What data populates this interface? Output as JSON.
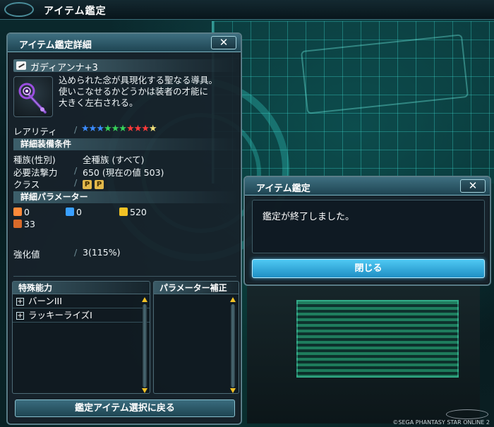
{
  "topbar": {
    "title": "アイテム鑑定"
  },
  "detail": {
    "title": "アイテム鑑定詳細",
    "close": "✕",
    "item_name": "ガディアンナ+3",
    "description": [
      "込められた念が具現化する聖なる導具。",
      "使いこなせるかどうかは装者の才能に",
      "大きく左右される。"
    ],
    "rarity_label": "レアリティ",
    "rarity_stars": [
      {
        "color": "#3b8cff"
      },
      {
        "color": "#3b8cff"
      },
      {
        "color": "#3b8cff"
      },
      {
        "color": "#37d35a"
      },
      {
        "color": "#37d35a"
      },
      {
        "color": "#37d35a"
      },
      {
        "color": "#ff3a3a"
      },
      {
        "color": "#ff3a3a"
      },
      {
        "color": "#ff3a3a"
      },
      {
        "color": "#f5e27a"
      }
    ],
    "equip_conditions": {
      "header": "詳細装備条件",
      "race_label": "種族(性別)",
      "race_value": "全種族 (すべて)",
      "power_label": "必要法撃力",
      "power_value": "650 (現在の値 503)",
      "class_label": "クラス",
      "class_icons": [
        "P",
        "P"
      ]
    },
    "params": {
      "header": "詳細パラメーター",
      "values": [
        {
          "icon": "sword-attack-icon",
          "value": "0",
          "color": "#ff8a3a"
        },
        {
          "icon": "gun-attack-icon",
          "value": "0",
          "color": "#3aa0ff"
        },
        {
          "icon": "tech-attack-icon",
          "value": "520",
          "color": "#f2c225"
        },
        {
          "icon": "dexterity-icon",
          "value": "33",
          "color": "#d86a2a"
        }
      ]
    },
    "enhance_label": "強化値",
    "enhance_value": "3(115%)",
    "special_abilities": {
      "header": "特殊能力",
      "items": [
        "バーンIII",
        "ラッキーライズI"
      ]
    },
    "param_correction": {
      "header": "パラメーター補正"
    },
    "back_button": "鑑定アイテム選択に戻る"
  },
  "dialog": {
    "title": "アイテム鑑定",
    "close": "✕",
    "message": "鑑定が終了しました。",
    "close_button": "閉じる"
  },
  "footer": {
    "copyright": "©SEGA PHANTASY STAR ONLINE 2",
    "logo": "PHANTASY STAR ONLINE 2"
  },
  "colors": {
    "dialog_button": "#2aa7dd",
    "accent_yellow": "#f2c225"
  }
}
